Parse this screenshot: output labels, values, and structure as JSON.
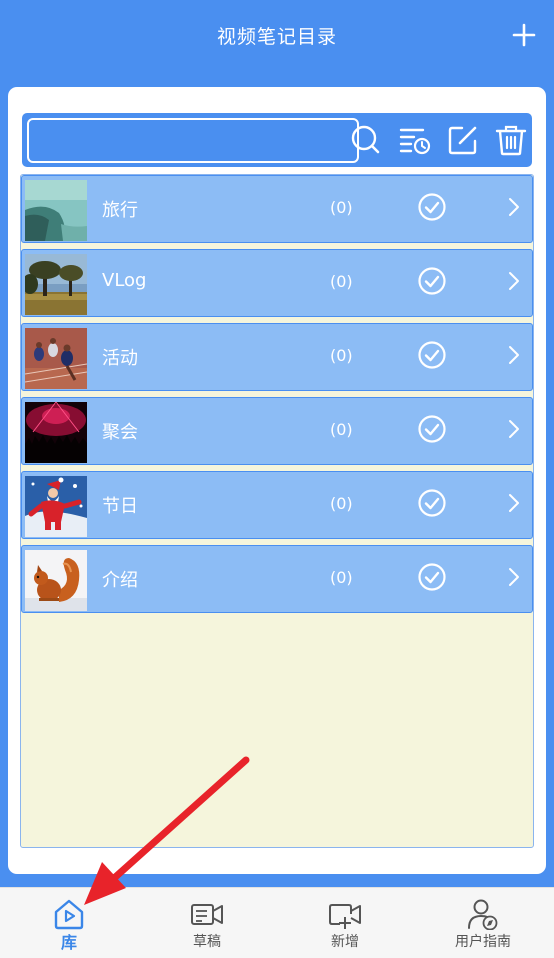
{
  "header": {
    "title": "视频笔记目录",
    "add_icon": "plus-icon"
  },
  "toolbar": {
    "search_value": "",
    "icons": [
      "search-icon",
      "list-time-icon",
      "edit-icon",
      "trash-icon"
    ]
  },
  "list": [
    {
      "label": "旅行",
      "count": "(0)",
      "thumb": "sea-island"
    },
    {
      "label": "VLog",
      "count": "(0)",
      "thumb": "park-trees"
    },
    {
      "label": "活动",
      "count": "(0)",
      "thumb": "sprinters"
    },
    {
      "label": "聚会",
      "count": "(0)",
      "thumb": "concert-crowd"
    },
    {
      "label": "节日",
      "count": "(0)",
      "thumb": "santa-claus"
    },
    {
      "label": "介绍",
      "count": "(0)",
      "thumb": "squirrel"
    }
  ],
  "bottom_nav": [
    {
      "label": "库",
      "icon": "library-home-icon",
      "active": true
    },
    {
      "label": "草稿",
      "icon": "draft-video-icon",
      "active": false
    },
    {
      "label": "新增",
      "icon": "new-video-icon",
      "active": false
    },
    {
      "label": "用户指南",
      "icon": "user-guide-icon",
      "active": false
    }
  ],
  "colors": {
    "primary": "#4a8ff0",
    "row": "#8cbcf5",
    "list_background": "#f5f5dc",
    "annotation_arrow": "#e8232a"
  }
}
